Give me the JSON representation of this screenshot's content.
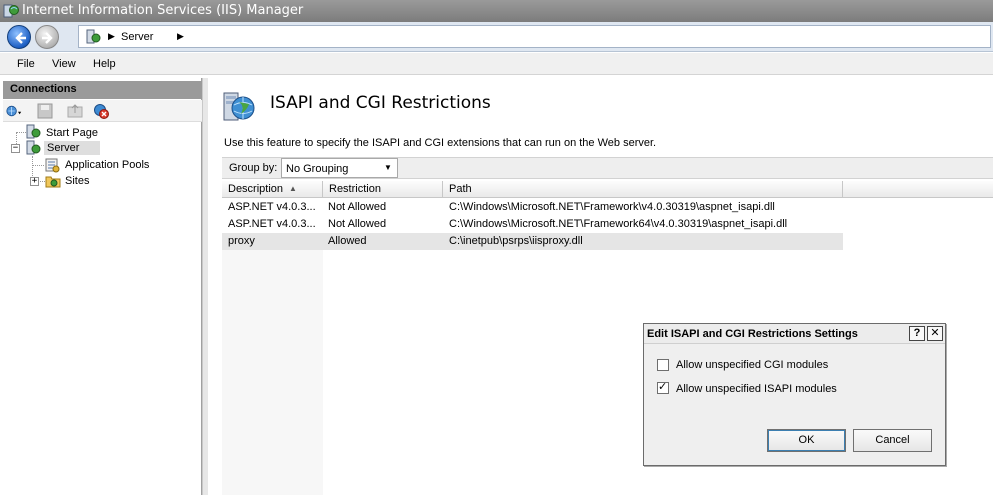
{
  "window": {
    "title": "Internet Information Services (IIS) Manager"
  },
  "address": {
    "crumb": "Server"
  },
  "menu": [
    "File",
    "View",
    "Help"
  ],
  "connections": {
    "header": "Connections",
    "tree": {
      "start_page": "Start Page",
      "server": "Server",
      "app_pools": "Application Pools",
      "sites": "Sites"
    }
  },
  "feature": {
    "title": "ISAPI and CGI Restrictions",
    "description": "Use this feature to specify the ISAPI and CGI extensions that can run on the Web server.",
    "group_by_label": "Group by:",
    "group_by_value": "No Grouping"
  },
  "table": {
    "columns": [
      "Description",
      "Restriction",
      "Path"
    ],
    "sort_indicator": "▲",
    "rows": [
      {
        "description": "ASP.NET v4.0.3...",
        "restriction": "Not Allowed",
        "path": "C:\\Windows\\Microsoft.NET\\Framework\\v4.0.30319\\aspnet_isapi.dll"
      },
      {
        "description": "ASP.NET v4.0.3...",
        "restriction": "Not Allowed",
        "path": "C:\\Windows\\Microsoft.NET\\Framework64\\v4.0.30319\\aspnet_isapi.dll"
      },
      {
        "description": "proxy",
        "restriction": "Allowed",
        "path": "C:\\inetpub\\psrps\\iisproxy.dll"
      }
    ]
  },
  "dialog": {
    "title": "Edit ISAPI and CGI Restrictions Settings",
    "help_glyph": "?",
    "close_glyph": "✕",
    "cgi_label": "Allow unspecified CGI modules",
    "cgi_checked": false,
    "isapi_label": "Allow unspecified ISAPI modules",
    "isapi_checked": true,
    "ok_label": "OK",
    "cancel_label": "Cancel"
  }
}
